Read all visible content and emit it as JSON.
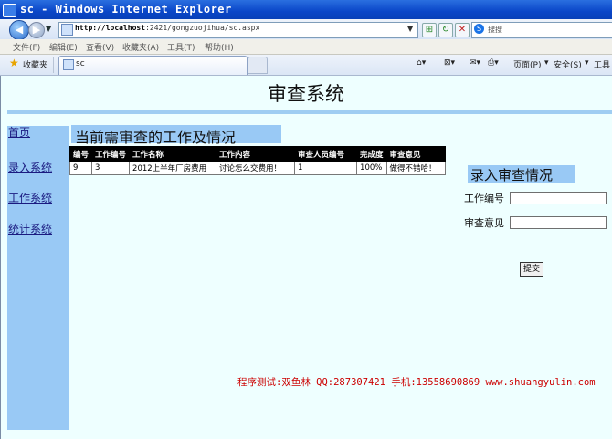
{
  "window": {
    "title": "sc - Windows Internet Explorer"
  },
  "address": {
    "host": "http://localhost",
    "path": ":2421/gongzuojihua/sc.aspx",
    "search_placeholder": "搜搜"
  },
  "menu": [
    "文件(F)",
    "编辑(E)",
    "查看(V)",
    "收藏夹(A)",
    "工具(T)",
    "帮助(H)"
  ],
  "favorites": {
    "label": "收藏夹"
  },
  "tab": {
    "title": "sc"
  },
  "command_bar": {
    "page": "页面(P)",
    "safety": "安全(S)",
    "tools": "工具"
  },
  "page": {
    "site_title": "审查系统",
    "nav": [
      {
        "label": "首页"
      },
      {
        "label": "录入系统"
      },
      {
        "label": "工作系统"
      },
      {
        "label": "统计系统"
      }
    ],
    "section_title": "当前需审查的工作及情况",
    "table": {
      "headers": [
        "编号",
        "工作编号",
        "工作名称",
        "工作内容",
        "审查人员编号",
        "完成度",
        "审查意见"
      ],
      "rows": [
        [
          "9",
          "3",
          "2012上半年厂房费用",
          "讨论怎么交费用！",
          "1",
          "100%",
          "做得不错哈！"
        ]
      ]
    },
    "form": {
      "title": "录入审查情况",
      "work_id_label": "工作编号",
      "opinion_label": "审查意见",
      "work_id_value": "",
      "opinion_value": "",
      "submit_label": "提交"
    },
    "footer": "程序测试:双鱼林 QQ:287307421 手机:13558690869 www.shuangyulin.com"
  }
}
